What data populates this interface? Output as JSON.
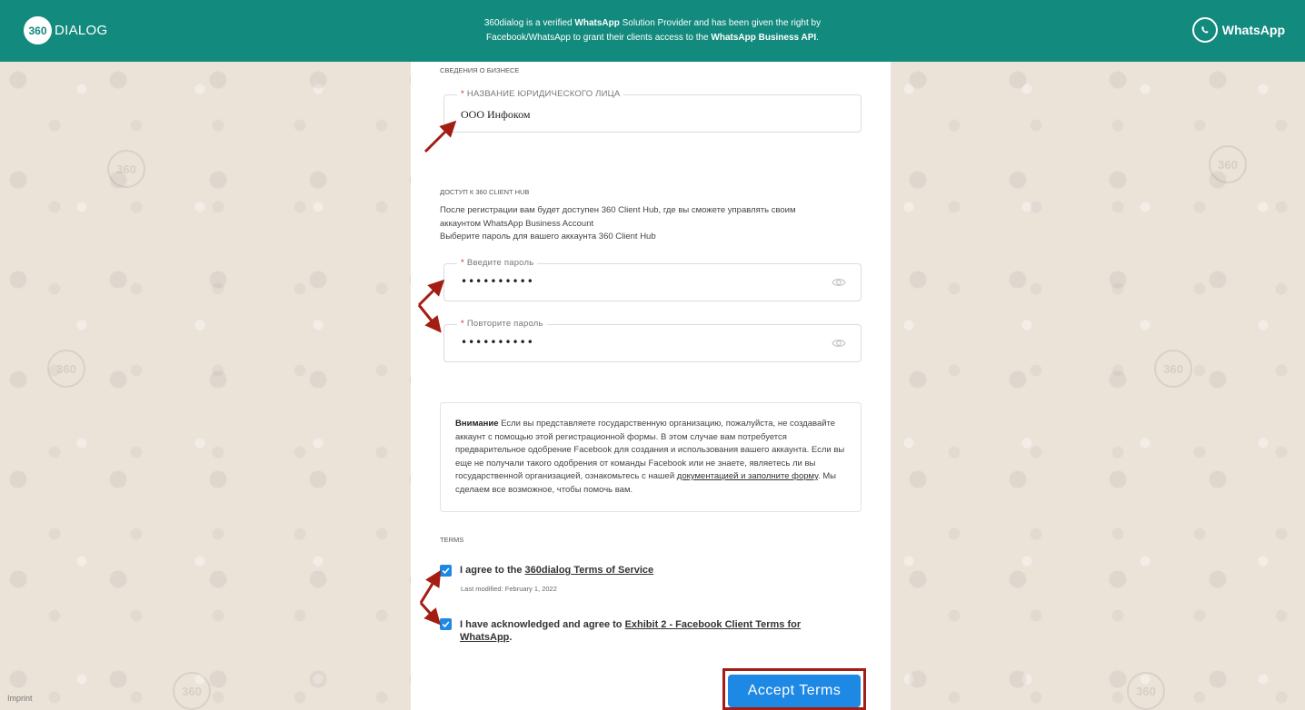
{
  "header": {
    "logo_number": "360",
    "logo_text": "DIALOG",
    "notice_part1": "360dialog is a verified ",
    "notice_bold1": "WhatsApp",
    "notice_part2": " Solution Provider and has been given the right by Facebook/WhatsApp to grant their clients access to the ",
    "notice_bold2": "WhatsApp Business API",
    "notice_part3": ".",
    "brand": "WhatsApp"
  },
  "business": {
    "section_label": "СВЕДЕНИЯ О БИЗНЕСЕ",
    "legal_name_label": "НАЗВАНИЕ ЮРИДИЧЕСКОГО ЛИЦА",
    "legal_name_value": "ООО Инфоком",
    "required_mark": "*"
  },
  "hub": {
    "section_label": "ДОСТУП К 360 CLIENT HUB",
    "line1": "После регистрации вам будет доступен 360 Client Hub, где вы сможете управлять своим",
    "line2": "аккаунтом WhatsApp Business Account",
    "line3": "Выберите пароль для вашего аккаунта 360 Client Hub",
    "password_label": "Введите пароль",
    "password_value": "••••••••••",
    "repeat_label": "Повторите пароль",
    "repeat_value": "••••••••••"
  },
  "warning": {
    "title": "Внимание",
    "text1": " Если вы представляете государственную организацию, пожалуйста, не создавайте аккаунт с помощью этой регистрационной формы. В этом случае вам потребуется предварительное одобрение Facebook для создания и использования вашего аккаунта. Если вы еще не получали такого одобрения от команды Facebook или не знаете, являетесь ли вы государственной организацией, ознакомьтесь с нашей ",
    "link": "документацией и заполните форму",
    "text2": ". Мы сделаем все возможное, чтобы помочь вам."
  },
  "terms": {
    "section_label": "TERMS",
    "tos_prefix": "I agree to the ",
    "tos_link": "360dialog Terms of Service",
    "tos_modified": "Last modified: February 1, 2022",
    "exhibit_prefix": "I have acknowledged and agree to ",
    "exhibit_link_line1": "Exhibit 2 - Facebook Client Terms for",
    "exhibit_link_line2": "WhatsApp",
    "exhibit_suffix": ".",
    "tos_checked": true,
    "exhibit_checked": true
  },
  "accept_button": "Accept Terms",
  "footer": {
    "imprint": "Imprint"
  },
  "colors": {
    "header": "#138a7e",
    "primary": "#1e88e5",
    "annotation": "#a41d14"
  }
}
